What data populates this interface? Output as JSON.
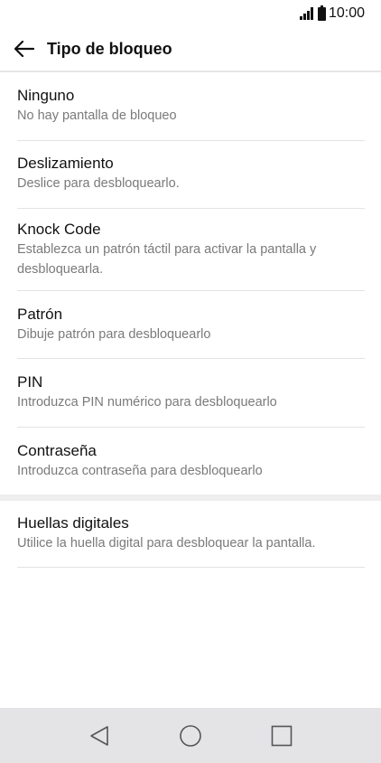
{
  "status_bar": {
    "time": "10:00",
    "icons": [
      "signal-icon",
      "battery-icon"
    ]
  },
  "app_bar": {
    "back_icon": "arrow-left-icon",
    "title": "Tipo de bloqueo"
  },
  "items": [
    {
      "title": "Ninguno",
      "subtitle": "No hay pantalla de bloqueo"
    },
    {
      "title": "Deslizamiento",
      "subtitle": "Deslice para desbloquearlo."
    },
    {
      "title": "Knock Code",
      "subtitle": "Establezca un patrón táctil para activar la pantalla y desbloquearla."
    },
    {
      "title": "Patrón",
      "subtitle": "Dibuje patrón para desbloquearlo"
    },
    {
      "title": "PIN",
      "subtitle": "Introduzca PIN numérico para desbloquearlo"
    },
    {
      "title": "Contraseña",
      "subtitle": "Introduzca contraseña para desbloquearlo"
    },
    {
      "title": "Huellas digitales",
      "subtitle": "Utilice la huella digital para desbloquear la pantalla."
    }
  ],
  "nav_bar": {
    "icons": [
      "back-triangle-icon",
      "home-circle-icon",
      "recents-square-icon"
    ]
  }
}
